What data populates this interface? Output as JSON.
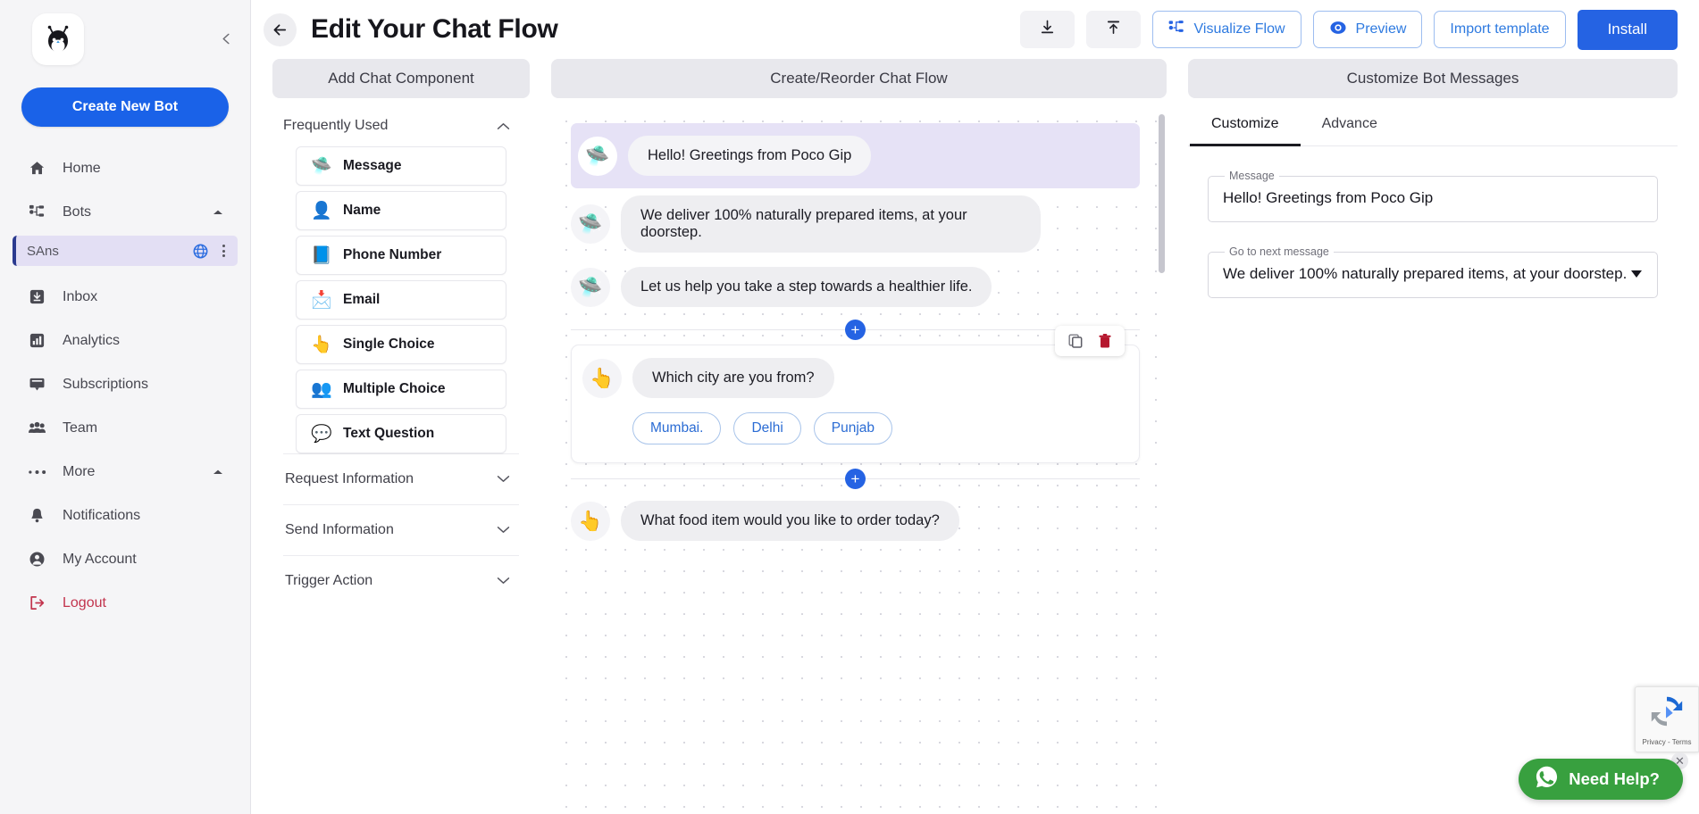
{
  "sidebar": {
    "logo_icon": "bot-logo-icon",
    "collapse_icon": "chevron-left-icon",
    "create_button": "Create New Bot",
    "items": [
      {
        "label": "Home",
        "icon": "home-icon"
      },
      {
        "label": "Bots",
        "icon": "bots-icon",
        "caret": "caret-up-icon"
      },
      {
        "label": "Inbox",
        "icon": "inbox-icon"
      },
      {
        "label": "Analytics",
        "icon": "analytics-icon"
      },
      {
        "label": "Subscriptions",
        "icon": "subscriptions-icon"
      },
      {
        "label": "Team",
        "icon": "team-icon"
      },
      {
        "label": "More",
        "icon": "more-icon",
        "caret": "caret-up-icon"
      },
      {
        "label": "Notifications",
        "icon": "bell-icon"
      },
      {
        "label": "My Account",
        "icon": "account-icon"
      },
      {
        "label": "Logout",
        "icon": "logout-icon"
      }
    ],
    "bot": {
      "name": "SAns",
      "globe_icon": "globe-icon",
      "menu_icon": "kebab-menu-icon"
    }
  },
  "header": {
    "back_icon": "arrow-left-icon",
    "title": "Edit Your Chat Flow",
    "download_icon": "download-icon",
    "upload_icon": "upload-icon",
    "visualize_label": "Visualize Flow",
    "visualize_icon": "flow-nodes-icon",
    "preview_label": "Preview",
    "preview_icon": "eye-icon",
    "import_label": "Import template",
    "install_label": "Install"
  },
  "panels": {
    "left_title": "Add Chat Component",
    "mid_title": "Create/Reorder Chat Flow",
    "right_title": "Customize Bot Messages"
  },
  "components": {
    "section_label": "Frequently Used",
    "section_caret": "chevron-up-icon",
    "items": [
      {
        "label": "Message",
        "emoji": "🛸",
        "icon": "paper-plane-icon"
      },
      {
        "label": "Name",
        "emoji": "👤",
        "icon": "person-icon"
      },
      {
        "label": "Phone Number",
        "emoji": "📘",
        "icon": "contact-book-icon"
      },
      {
        "label": "Email",
        "emoji": "📩",
        "icon": "envelope-icon"
      },
      {
        "label": "Single Choice",
        "emoji": "👆",
        "icon": "pointing-hand-icon"
      },
      {
        "label": "Multiple Choice",
        "emoji": "👥",
        "icon": "group-choice-icon"
      },
      {
        "label": "Text Question",
        "emoji": "💬",
        "icon": "question-bubble-icon"
      }
    ],
    "collapsed_sections": [
      {
        "label": "Request Information",
        "caret": "chevron-down-icon"
      },
      {
        "label": "Send Information",
        "caret": "chevron-down-icon"
      },
      {
        "label": "Trigger Action",
        "caret": "chevron-down-icon"
      }
    ]
  },
  "flow": {
    "messages": [
      {
        "text": "Hello! Greetings from Poco Gip",
        "emoji": "🛸",
        "selected": true
      },
      {
        "text": "We deliver 100% naturally prepared items, at your doorstep.",
        "emoji": "🛸",
        "selected": false
      },
      {
        "text": "Let us help you take a step towards a healthier life.",
        "emoji": "🛸",
        "selected": false
      }
    ],
    "add_icon": "plus-circle-icon",
    "choice_card": {
      "question": "Which city are you from?",
      "emoji": "👆",
      "options": [
        "Mumbai.",
        "Delhi",
        "Punjab"
      ],
      "copy_icon": "copy-icon",
      "delete_icon": "trash-icon"
    },
    "last_message": {
      "text": "What food item would you like to order today?",
      "emoji": "👆"
    }
  },
  "customize": {
    "tabs": [
      {
        "label": "Customize",
        "active": true
      },
      {
        "label": "Advance",
        "active": false
      }
    ],
    "message_label": "Message",
    "message_value": "Hello! Greetings from Poco Gip",
    "next_label": "Go to next message",
    "next_value": "We deliver 100% naturally prepared items, at your doorstep."
  },
  "widgets": {
    "recaptcha_text": "Privacy - Terms",
    "recaptcha_icon": "recaptcha-icon",
    "whatsapp_label": "Need  Help?",
    "whatsapp_icon": "whatsapp-icon",
    "close_icon": "close-icon"
  },
  "colors": {
    "primary": "#2563e3",
    "accent_link": "#2e7ae0",
    "selected_bubble": "#e6e2f6",
    "logout": "#c2344d",
    "whatsapp": "#38a03f"
  }
}
